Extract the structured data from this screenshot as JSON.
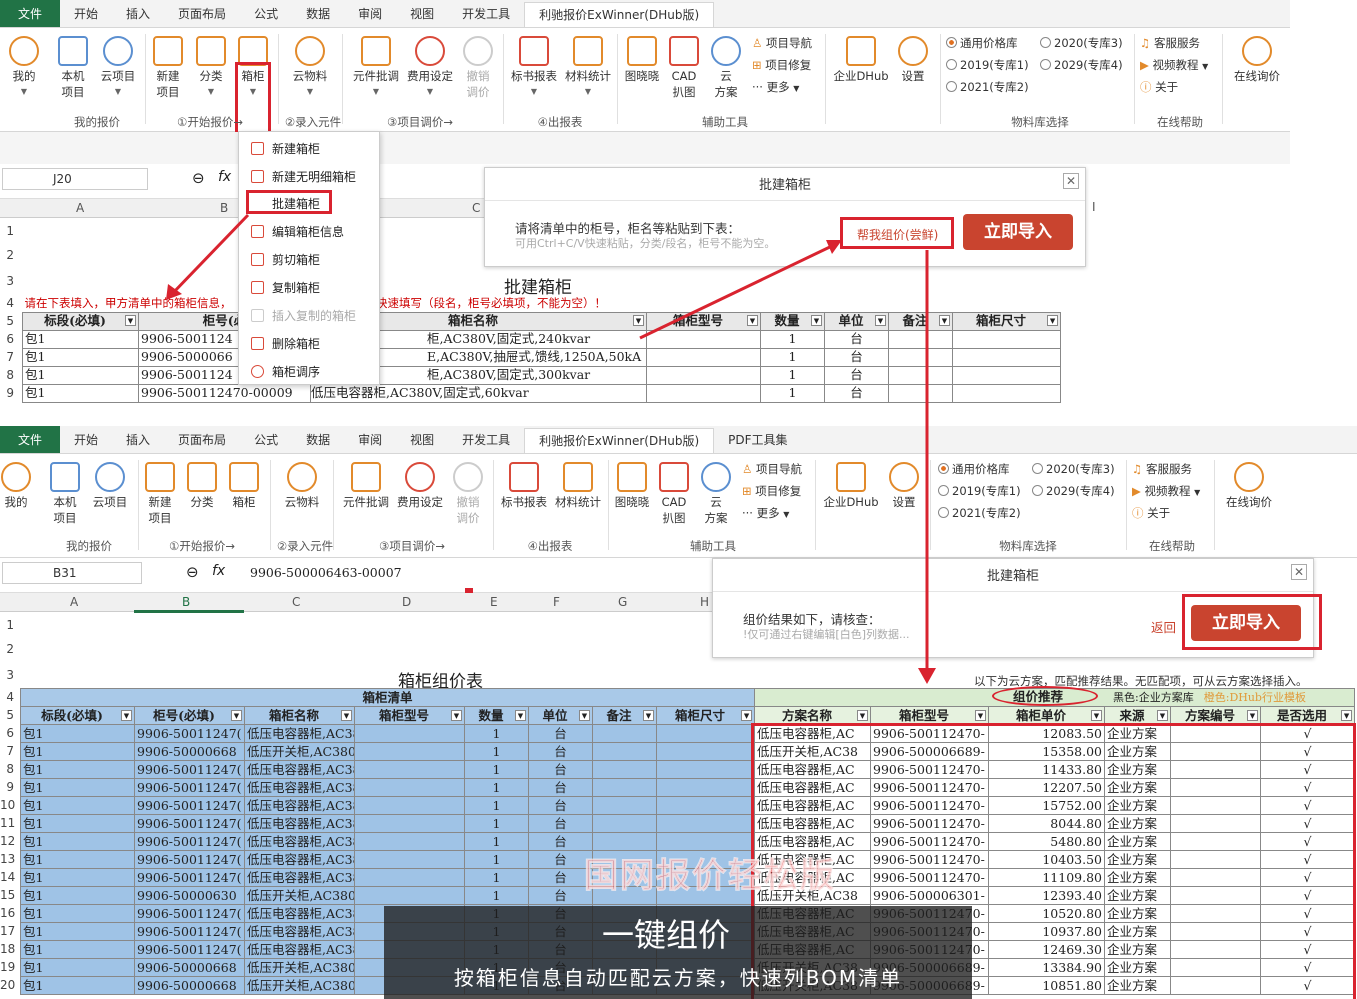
{
  "tabs": [
    "文件",
    "开始",
    "插入",
    "页面布局",
    "公式",
    "数据",
    "审阅",
    "视图",
    "开发工具",
    "利驰报价ExWinner(DHub版)"
  ],
  "tabs2": [
    "文件",
    "开始",
    "插入",
    "页面布局",
    "公式",
    "数据",
    "审阅",
    "视图",
    "开发工具",
    "利驰报价ExWinner(DHub版)",
    "PDF工具集"
  ],
  "ribbon": {
    "my": "我的",
    "local": "本机\n项目",
    "cloud": "云项目",
    "new": "新建\n项目",
    "classify": "分类",
    "box": "箱柜",
    "cloudmat": "云物料",
    "batch": "元件批调",
    "fee": "费用设定",
    "undo": "撤销\n调价",
    "bid": "标书报表",
    "mat": "材料统计",
    "tuxiao": "图晓晓",
    "cad": "CAD\n扒图",
    "cloudplan": "云\n方案",
    "nav": "项目导航",
    "repair": "项目修复",
    "more": "更多",
    "dhub": "企业DHub",
    "settings": "设置",
    "lib_general": "通用价格库",
    "lib2019": "2019(专库1)",
    "lib2021": "2021(专库2)",
    "lib2020": "2020(专库3)",
    "lib2029": "2029(专库4)",
    "service": "客服服务",
    "video": "视频教程",
    "about": "关于",
    "online": "在线询价",
    "g_my": "我的报价",
    "g_start": "①开始报价→",
    "g_input": "②录入元件",
    "g_adjust": "③项目调价→",
    "g_report": "④出报表",
    "g_aux": "辅助工具",
    "g_lib": "物料库选择",
    "g_help": "在线帮助"
  },
  "top": {
    "namebox": "J20",
    "fx": "fx",
    "cols": [
      "A",
      "B",
      "C",
      "I"
    ],
    "sheet_title": "批建箱柜",
    "notice": "请在下表填入，甲方清单中的箱柜信息，",
    "notice2": "C/V键快速填写（段名，柜号必填项，不能为空）！",
    "headers": [
      "标段(必填)",
      "柜号(必",
      "箱柜名称",
      "箱柜型号",
      "数量",
      "单位",
      "备注",
      "箱柜尺寸"
    ],
    "rows": [
      [
        "包1",
        "9906-5001124",
        "柜,AC380V,固定式,240kvar",
        "",
        "1",
        "台"
      ],
      [
        "包1",
        "9906-5000066",
        "E,AC380V,抽屉式,馈线,1250A,50kA",
        "",
        "1",
        "台"
      ],
      [
        "包1",
        "9906-5001124",
        "柜,AC380V,固定式,300kvar",
        "",
        "1",
        "台"
      ],
      [
        "包1",
        "9906-500112470-00009",
        "低压电容器柜,AC380V,固定式,60kvar",
        "",
        "1",
        "台"
      ]
    ],
    "rownums": [
      "1",
      "2",
      "3",
      "4",
      "5",
      "6",
      "7",
      "8",
      "9"
    ]
  },
  "menu": [
    "新建箱柜",
    "新建无明细箱柜",
    "批建箱柜",
    "编辑箱柜信息",
    "剪切箱柜",
    "复制箱柜",
    "插入复制的箱柜",
    "删除箱柜",
    "箱柜调序"
  ],
  "dialog1": {
    "title": "批建箱柜",
    "line1": "请将清单中的柜号，柜名等粘贴到下表：",
    "line2": "可用Ctrl+C/V快速粘贴，分类/段名，柜号不能为空。",
    "help": "帮我组价(尝鲜)",
    "import": "立即导入"
  },
  "bottom": {
    "namebox": "B31",
    "fx": "fx",
    "formula": "9906-500006463-00007",
    "cols": [
      "A",
      "B",
      "C",
      "D",
      "E",
      "F",
      "G",
      "H"
    ],
    "sheet_title": "箱柜组价表",
    "list_hdr": "箱柜清单",
    "rec_hdr": "组价推荐",
    "rec_note": "以下为云方案，匹配推荐结果。无匹配项，可从云方案选择插入。",
    "legend1": "黑色:企业方案库",
    "legend2": "橙色:DHub行业模板",
    "headers": [
      "标段(必填)",
      "柜号(必填)",
      "箱柜名称",
      "箱柜型号",
      "数量",
      "单位",
      "备注",
      "箱柜尺寸"
    ],
    "rheaders": [
      "方案名称",
      "箱柜型号",
      "箱柜单价",
      "来源",
      "方案编号",
      "是否选用"
    ],
    "rownums": [
      "1",
      "2",
      "3",
      "4",
      "5",
      "6",
      "7",
      "8",
      "9",
      "10",
      "11",
      "12",
      "13",
      "14",
      "15",
      "16",
      "17",
      "18",
      "19",
      "20"
    ],
    "rows": [
      [
        "包1",
        "9906-50011247(",
        "低压电容器柜,AC380V,固定式,2",
        ""
      ],
      [
        "包1",
        "9906-50000668",
        "低压开关柜,AC380V,抽屉式,馈线",
        ""
      ],
      [
        "包1",
        "9906-50011247(",
        "低压电容器柜,AC380V,固定式,3(",
        ""
      ],
      [
        "包1",
        "9906-50011247(",
        "低压电容器柜,AC380V,固定式,6(",
        ""
      ],
      [
        "包1",
        "9906-50011247(",
        "低压电容器柜,AC380V,固定式,1(",
        ""
      ],
      [
        "包1",
        "9906-50011247(",
        "低压电容器柜,AC380V,固定式,1(",
        ""
      ],
      [
        "包1",
        "9906-50011247(",
        "低压电容器柜,AC380V,固定式,1:",
        ""
      ],
      [
        "包1",
        "9906-50011247(",
        "低压电容器柜,AC380V,固定式,1:",
        ""
      ],
      [
        "包1",
        "9906-50011247(",
        "低压电容器柜,AC380V,固定式,1:",
        ""
      ],
      [
        "包1",
        "9906-50000630",
        "低压开关柜,AC380V,固定式,分段",
        ""
      ],
      [
        "包1",
        "9906-50011247(",
        "低压电容器柜,AC380V,固定式,3(",
        ""
      ],
      [
        "包1",
        "9906-50011247(",
        "低压电容器柜,AC380V,固定式,3(",
        ""
      ],
      [
        "包1",
        "9906-50011247(",
        "低压电容器柜,AC380V,固定式,3(",
        ""
      ],
      [
        "包1",
        "9906-50000668",
        "低压开关柜,AC380V,抽屉式,馈线",
        ""
      ],
      [
        "包1",
        "9906-50000668",
        "低压开关柜,AC380V,抽屉式,馈线",
        ""
      ]
    ],
    "rrows": [
      [
        "低压电容器柜,AC",
        "9906-500112470-",
        "12083.50",
        "企业方案"
      ],
      [
        "低压开关柜,AC38",
        "9906-500006689-",
        "15358.00",
        "企业方案"
      ],
      [
        "低压电容器柜,AC",
        "9906-500112470-",
        "11433.80",
        "企业方案"
      ],
      [
        "低压电容器柜,AC",
        "9906-500112470-",
        "12207.50",
        "企业方案"
      ],
      [
        "低压电容器柜,AC",
        "9906-500112470-",
        "15752.00",
        "企业方案"
      ],
      [
        "低压电容器柜,AC",
        "9906-500112470-",
        "8044.80",
        "企业方案"
      ],
      [
        "低压电容器柜,AC",
        "9906-500112470-",
        "5480.80",
        "企业方案"
      ],
      [
        "低压电容器柜,AC",
        "9906-500112470-",
        "10403.50",
        "企业方案"
      ],
      [
        "低压电容器柜,AC",
        "9906-500112470-",
        "11109.80",
        "企业方案"
      ],
      [
        "低压开关柜,AC38",
        "9906-500006301-",
        "12393.40",
        "企业方案"
      ],
      [
        "低压电容器柜,AC",
        "9906-500112470-",
        "10520.80",
        "企业方案"
      ],
      [
        "低压电容器柜,AC",
        "9906-500112470-",
        "10937.80",
        "企业方案"
      ],
      [
        "低压电容器柜,AC",
        "9906-500112470-",
        "12469.30",
        "企业方案"
      ],
      [
        "低压开关柜,AC38",
        "9906-500006689-",
        "13384.90",
        "企业方案"
      ],
      [
        "低压开关柜,AC38",
        "9906-500006689-",
        "10851.80",
        "企业方案"
      ]
    ],
    "check": "√"
  },
  "dialog2": {
    "title": "批建箱柜",
    "line1": "组价结果如下，请核查：",
    "line2": "!仅可通过右键编辑[白色]列数据...",
    "back": "返回",
    "import": "立即导入"
  },
  "caption": {
    "brand": "国网报价轻松版",
    "title": "一键组价",
    "sub": "按箱柜信息自动匹配云方案，快速列BOM清单"
  },
  "colors": {
    "accent": "#d9232f",
    "excel_green": "#217346",
    "blue_fill": "#9fc3e6",
    "green_fill": "#e6f2df"
  }
}
